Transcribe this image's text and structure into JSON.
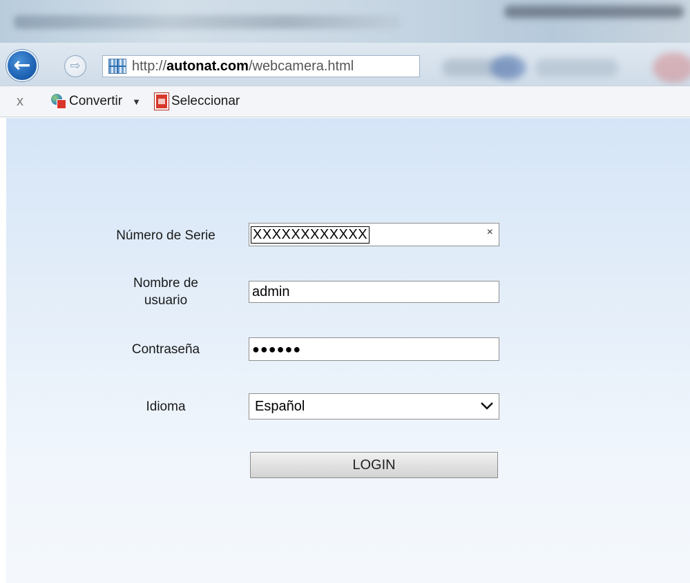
{
  "browser": {
    "url_prefix": "http://",
    "url_host": "autonat.com",
    "url_path": "/webcamera.html"
  },
  "toolbar": {
    "close": "x",
    "convert_label": "Convertir",
    "convert_caret": "▼",
    "select_label": "Seleccionar"
  },
  "form": {
    "serial_label": "Número de Serie",
    "serial_value": "XXXXXXXXXXXX",
    "serial_clear": "×",
    "username_label_line1": "Nombre de",
    "username_label_line2": "usuario",
    "username_value": "admin",
    "password_label": "Contraseña",
    "password_value": "●●●●●●",
    "language_label": "Idioma",
    "language_value": "Español",
    "login_label": "LOGIN"
  }
}
